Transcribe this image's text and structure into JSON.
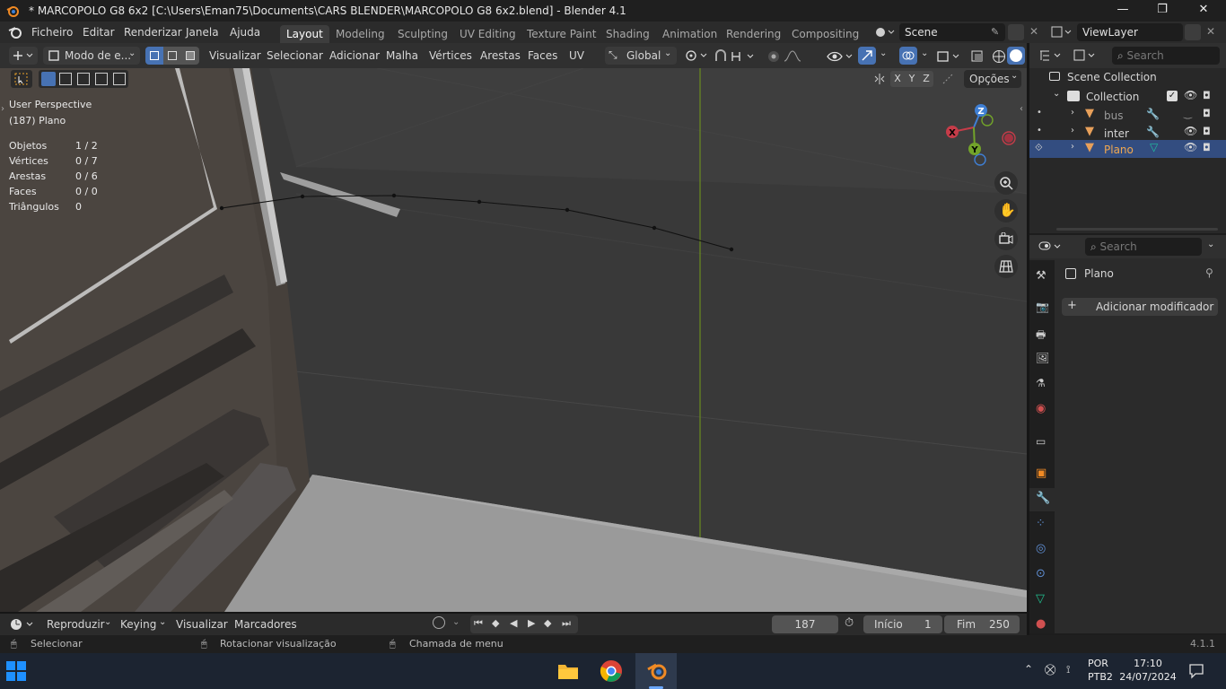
{
  "window": {
    "title": "* MARCOPOLO G8 6x2 [C:\\Users\\Eman75\\Documents\\CARS BLENDER\\MARCOPOLO G8 6x2.blend] - Blender 4.1",
    "minimize": "—",
    "maximize": "❐",
    "close": "✕"
  },
  "menu": {
    "items": [
      "Ficheiro",
      "Editar",
      "Renderizar",
      "Janela",
      "Ajuda"
    ]
  },
  "workspaces": [
    "Layout",
    "Modeling",
    "Sculpting",
    "UV Editing",
    "Texture Paint",
    "Shading",
    "Animation",
    "Rendering",
    "Compositing"
  ],
  "scene_field": "Scene",
  "viewlayer_field": "ViewLayer",
  "viewport_header": {
    "mode": "Modo de e...",
    "menus": [
      "Visualizar",
      "Selecionar",
      "Adicionar",
      "Malha",
      "Vértices",
      "Arestas",
      "Faces",
      "UV"
    ],
    "orientation": "Global",
    "options": "Opções",
    "axes": [
      "X",
      "Y",
      "Z"
    ]
  },
  "overlay": {
    "view_name": "User Perspective",
    "object_label": "(187) Plano",
    "stats": [
      {
        "label": "Objetos",
        "value": "1 / 2"
      },
      {
        "label": "Vértices",
        "value": "0 / 7"
      },
      {
        "label": "Arestas",
        "value": "0 / 6"
      },
      {
        "label": "Faces",
        "value": "0 / 0"
      },
      {
        "label": "Triângulos",
        "value": "0"
      }
    ]
  },
  "gizmo": {
    "x": "X",
    "y": "Y",
    "z": "Z"
  },
  "outliner": {
    "search_placeholder": "Search",
    "scene_collection": "Scene Collection",
    "collection": "Collection",
    "objects": [
      "bus",
      "inter",
      "Plano"
    ]
  },
  "properties": {
    "search_placeholder": "Search",
    "object_name": "Plano",
    "add_modifier": "Adicionar modificador"
  },
  "timeline": {
    "menus": [
      "Reproduzir",
      "Keying",
      "Visualizar",
      "Marcadores"
    ],
    "current_frame": "187",
    "start_label": "Início",
    "start_value": "1",
    "end_label": "Fim",
    "end_value": "250"
  },
  "statusbar": {
    "select": "Selecionar",
    "rotate": "Rotacionar visualização",
    "menu_call": "Chamada de menu",
    "version": "4.1.1"
  },
  "taskbar": {
    "lang": "POR",
    "layout": "PTB2",
    "time": "17:10",
    "date": "24/07/2024"
  },
  "colors": {
    "accent": "#4772b3",
    "x_axis": "#c63c49",
    "y_axis": "#72a32a",
    "z_axis": "#3f7fd4"
  }
}
